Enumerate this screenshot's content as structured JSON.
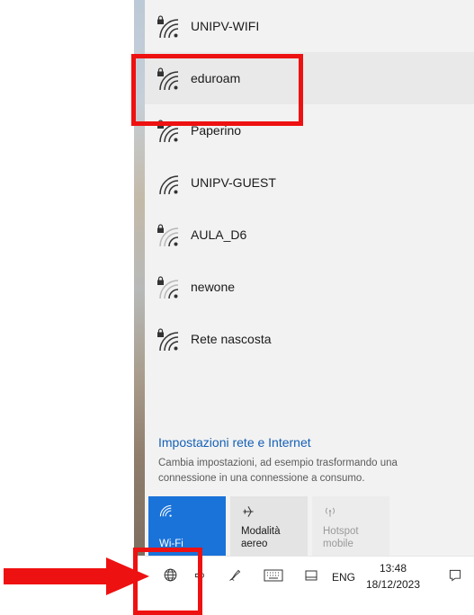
{
  "networks": [
    {
      "name": "UNIPV-WIFI",
      "secured": true,
      "signal": "full",
      "selected": false
    },
    {
      "name": "eduroam",
      "secured": true,
      "signal": "full",
      "selected": true
    },
    {
      "name": "Paperino",
      "secured": true,
      "signal": "full",
      "selected": false
    },
    {
      "name": "UNIPV-GUEST",
      "secured": false,
      "signal": "full",
      "selected": false
    },
    {
      "name": "AULA_D6",
      "secured": true,
      "signal": "weak",
      "selected": false
    },
    {
      "name": "newone",
      "secured": true,
      "signal": "weak",
      "selected": false
    },
    {
      "name": "Rete nascosta",
      "secured": true,
      "signal": "full",
      "selected": false
    }
  ],
  "settings": {
    "link": "Impostazioni rete e Internet",
    "description": "Cambia impostazioni, ad esempio trasformando una connessione in una connessione a consumo."
  },
  "quick_actions": {
    "wifi": {
      "label": "Wi-Fi",
      "icon": "wifi-icon",
      "state": "on"
    },
    "airplane": {
      "label_line1": "Modalità",
      "label_line2": "aereo",
      "icon": "airplane-icon",
      "state": "off"
    },
    "hotspot": {
      "label_line1": "Hotspot",
      "label_line2": "mobile",
      "icon": "hotspot-icon",
      "state": "disabled"
    }
  },
  "taskbar": {
    "language": "ENG",
    "time": "13:48",
    "date": "18/12/2023"
  },
  "colors": {
    "accent": "#1a73d9",
    "annotation": "#ee1111",
    "panel": "#f2f2f2"
  }
}
